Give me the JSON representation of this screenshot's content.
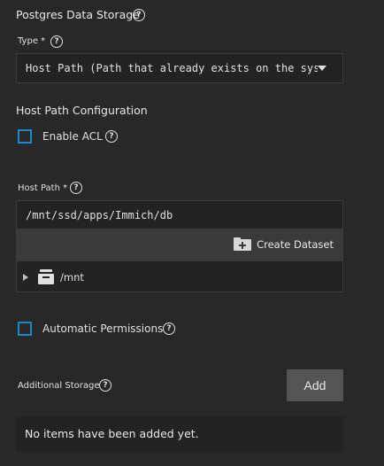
{
  "postgres_storage": {
    "title": "Postgres Data Storage",
    "type_label": "Type *",
    "type_value": "Host Path (Path that already exists on the system)"
  },
  "host_path_config": {
    "title": "Host Path Configuration",
    "enable_acl_label": "Enable ACL",
    "enable_acl_checked": false,
    "host_path_label": "Host Path *",
    "host_path_value": "/mnt/ssd/apps/Immich/db",
    "create_dataset_label": "Create Dataset",
    "tree_root_label": "/mnt",
    "automatic_permissions_label": "Automatic Permissions",
    "automatic_permissions_checked": false
  },
  "additional_storage": {
    "label": "Additional Storage",
    "add_label": "Add",
    "empty_message": "No items have been added yet."
  },
  "help_glyph": "?",
  "icons": [
    "help-icon",
    "folder-plus-icon",
    "dataset-icon",
    "caret-right-icon",
    "dropdown-arrow-icon"
  ],
  "colors": {
    "background": "#282828",
    "checkbox_border": "#1e88c9",
    "button_bg": "#545454"
  }
}
